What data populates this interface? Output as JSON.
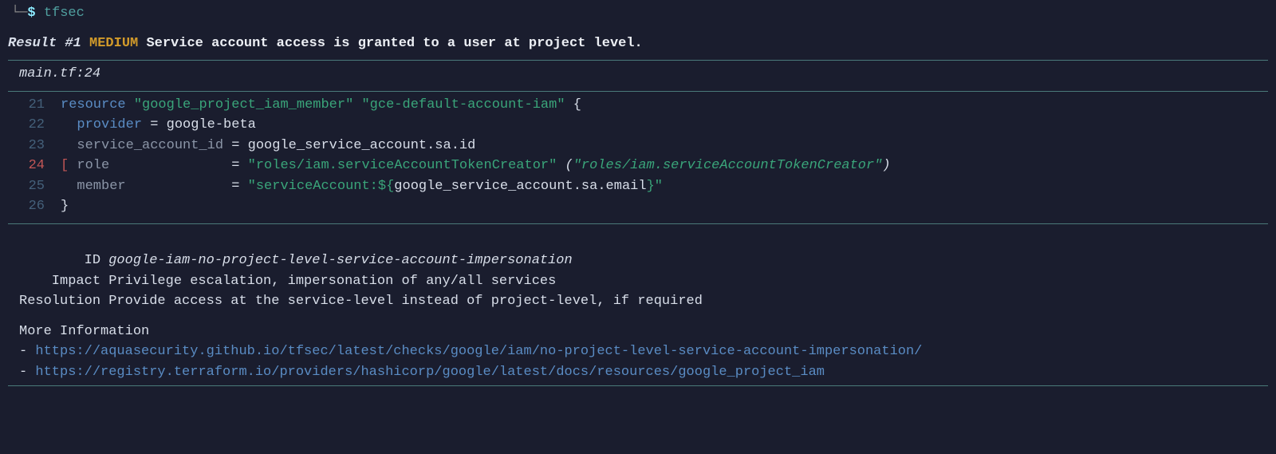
{
  "prompt": {
    "branch": "└─",
    "symbol": "$",
    "command": "tfsec"
  },
  "result": {
    "label": "Result #1",
    "severity": "MEDIUM",
    "message": "Service account access is granted to a user at project level."
  },
  "file_location": "main.tf:24",
  "code": {
    "lines": [
      {
        "num": "21",
        "hl": false
      },
      {
        "num": "22",
        "hl": false
      },
      {
        "num": "23",
        "hl": false
      },
      {
        "num": "24",
        "hl": true
      },
      {
        "num": "25",
        "hl": false
      },
      {
        "num": "26",
        "hl": false
      }
    ],
    "l21": {
      "kw": "resource",
      "str1": "\"google_project_iam_member\"",
      "str2": "\"gce-default-account-iam\"",
      "brace": "{"
    },
    "l22": {
      "kw": "provider",
      "eq": " = ",
      "val": "google-beta"
    },
    "l23": {
      "attr": "service_account_id",
      "eq": " = ",
      "val": "google_service_account.sa.id"
    },
    "l24": {
      "bracket": "[",
      "attr": "role",
      "eq": "= ",
      "str": "\"roles/iam.serviceAccountTokenCreator\"",
      "paren_open": " (",
      "paren_str": "\"roles/iam.serviceAccountTokenCreator\"",
      "paren_close": ")"
    },
    "l25": {
      "attr": "member",
      "eq": "= ",
      "q1": "\"serviceAccount:",
      "interp_open": "${",
      "interp": "google_service_account.sa.email",
      "interp_close": "}",
      "q2": "\""
    },
    "l26": {
      "brace": "}"
    }
  },
  "details": {
    "id_label": "        ID ",
    "id": "google-iam-no-project-level-service-account-impersonation",
    "impact_label": "    Impact ",
    "impact": "Privilege escalation, impersonation of any/all services",
    "resolution_label": "Resolution ",
    "resolution": "Provide access at the service-level instead of project-level, if required"
  },
  "more_info": {
    "title": "More Information",
    "links": [
      "https://aquasecurity.github.io/tfsec/latest/checks/google/iam/no-project-level-service-account-impersonation/",
      "https://registry.terraform.io/providers/hashicorp/google/latest/docs/resources/google_project_iam"
    ]
  }
}
